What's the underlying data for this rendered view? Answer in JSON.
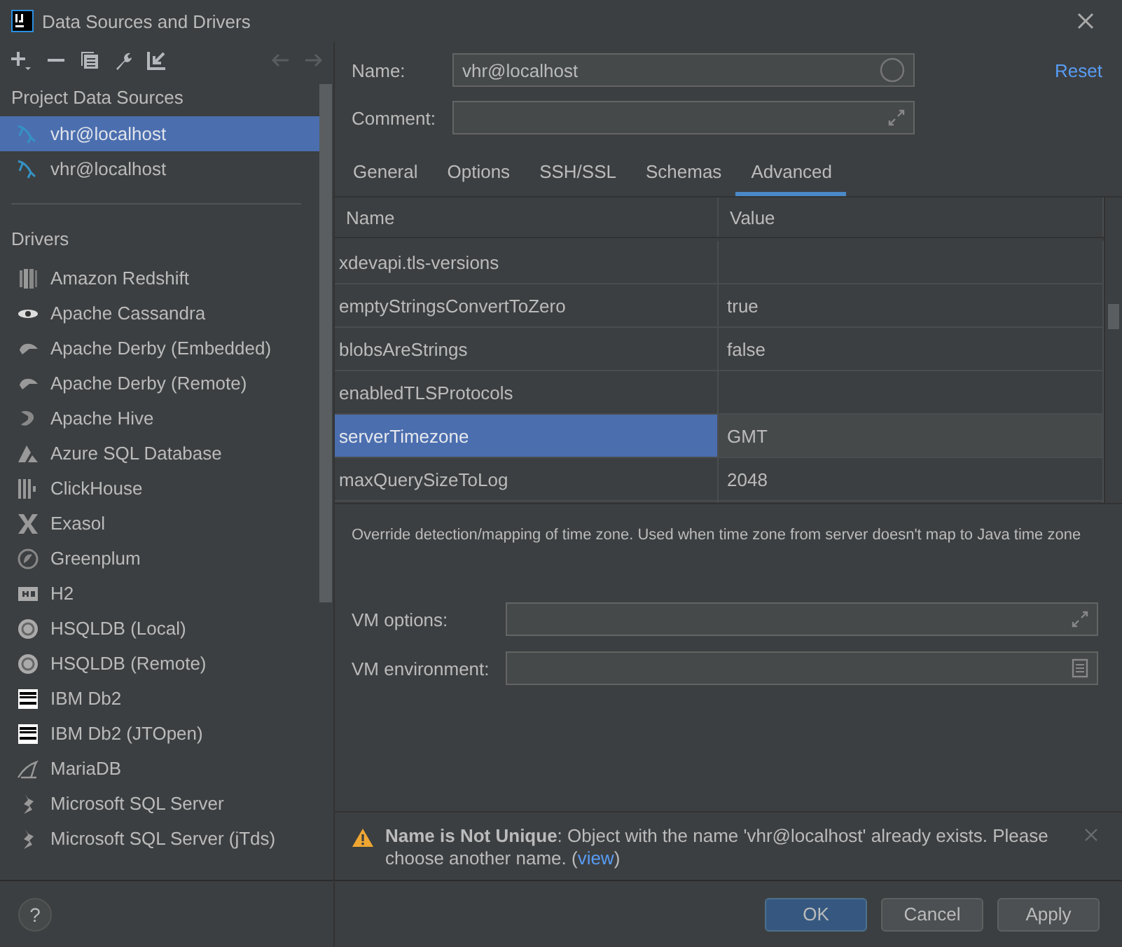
{
  "window": {
    "title": "Data Sources and Drivers"
  },
  "sidebar": {
    "project_heading": "Project Data Sources",
    "project_items": [
      {
        "label": "vhr@localhost",
        "selected": true
      },
      {
        "label": "vhr@localhost",
        "selected": false
      }
    ],
    "drivers_heading": "Drivers",
    "drivers": [
      {
        "label": "Amazon Redshift"
      },
      {
        "label": "Apache Cassandra"
      },
      {
        "label": "Apache Derby (Embedded)"
      },
      {
        "label": "Apache Derby (Remote)"
      },
      {
        "label": "Apache Hive"
      },
      {
        "label": "Azure SQL Database"
      },
      {
        "label": "ClickHouse"
      },
      {
        "label": "Exasol"
      },
      {
        "label": "Greenplum"
      },
      {
        "label": "H2"
      },
      {
        "label": "HSQLDB (Local)"
      },
      {
        "label": "HSQLDB (Remote)"
      },
      {
        "label": "IBM Db2"
      },
      {
        "label": "IBM Db2 (JTOpen)"
      },
      {
        "label": "MariaDB"
      },
      {
        "label": "Microsoft SQL Server"
      },
      {
        "label": "Microsoft SQL Server (jTds)"
      }
    ],
    "help": "?"
  },
  "form": {
    "name_label": "Name:",
    "name_value": "vhr@localhost",
    "comment_label": "Comment:",
    "reset": "Reset"
  },
  "tabs": [
    {
      "label": "General",
      "selected": false
    },
    {
      "label": "Options",
      "selected": false
    },
    {
      "label": "SSH/SSL",
      "selected": false
    },
    {
      "label": "Schemas",
      "selected": false
    },
    {
      "label": "Advanced",
      "selected": true
    }
  ],
  "table": {
    "columns": [
      "Name",
      "Value"
    ],
    "rows": [
      {
        "name": "xdevapi.tls-versions",
        "value": "",
        "selected": false
      },
      {
        "name": "emptyStringsConvertToZero",
        "value": "true",
        "selected": false
      },
      {
        "name": "blobsAreStrings",
        "value": "false",
        "selected": false
      },
      {
        "name": "enabledTLSProtocols",
        "value": "",
        "selected": false
      },
      {
        "name": "serverTimezone",
        "value": "GMT",
        "selected": true
      },
      {
        "name": "maxQuerySizeToLog",
        "value": "2048",
        "selected": false
      }
    ]
  },
  "description": "Override detection/mapping of time zone. Used when time zone from server doesn't map to Java time zone",
  "vm": {
    "options_label": "VM options:",
    "environment_label": "VM environment:"
  },
  "warning": {
    "message": "**Name is Not Unique**: Object with the name 'vhr@localhost' already exists. Please choose another name. (",
    "link": "view",
    "message_end": ")"
  },
  "buttons": [
    {
      "label": "OK",
      "default": true
    },
    {
      "label": "Cancel",
      "default": false
    },
    {
      "label": "Apply",
      "default": false
    }
  ]
}
